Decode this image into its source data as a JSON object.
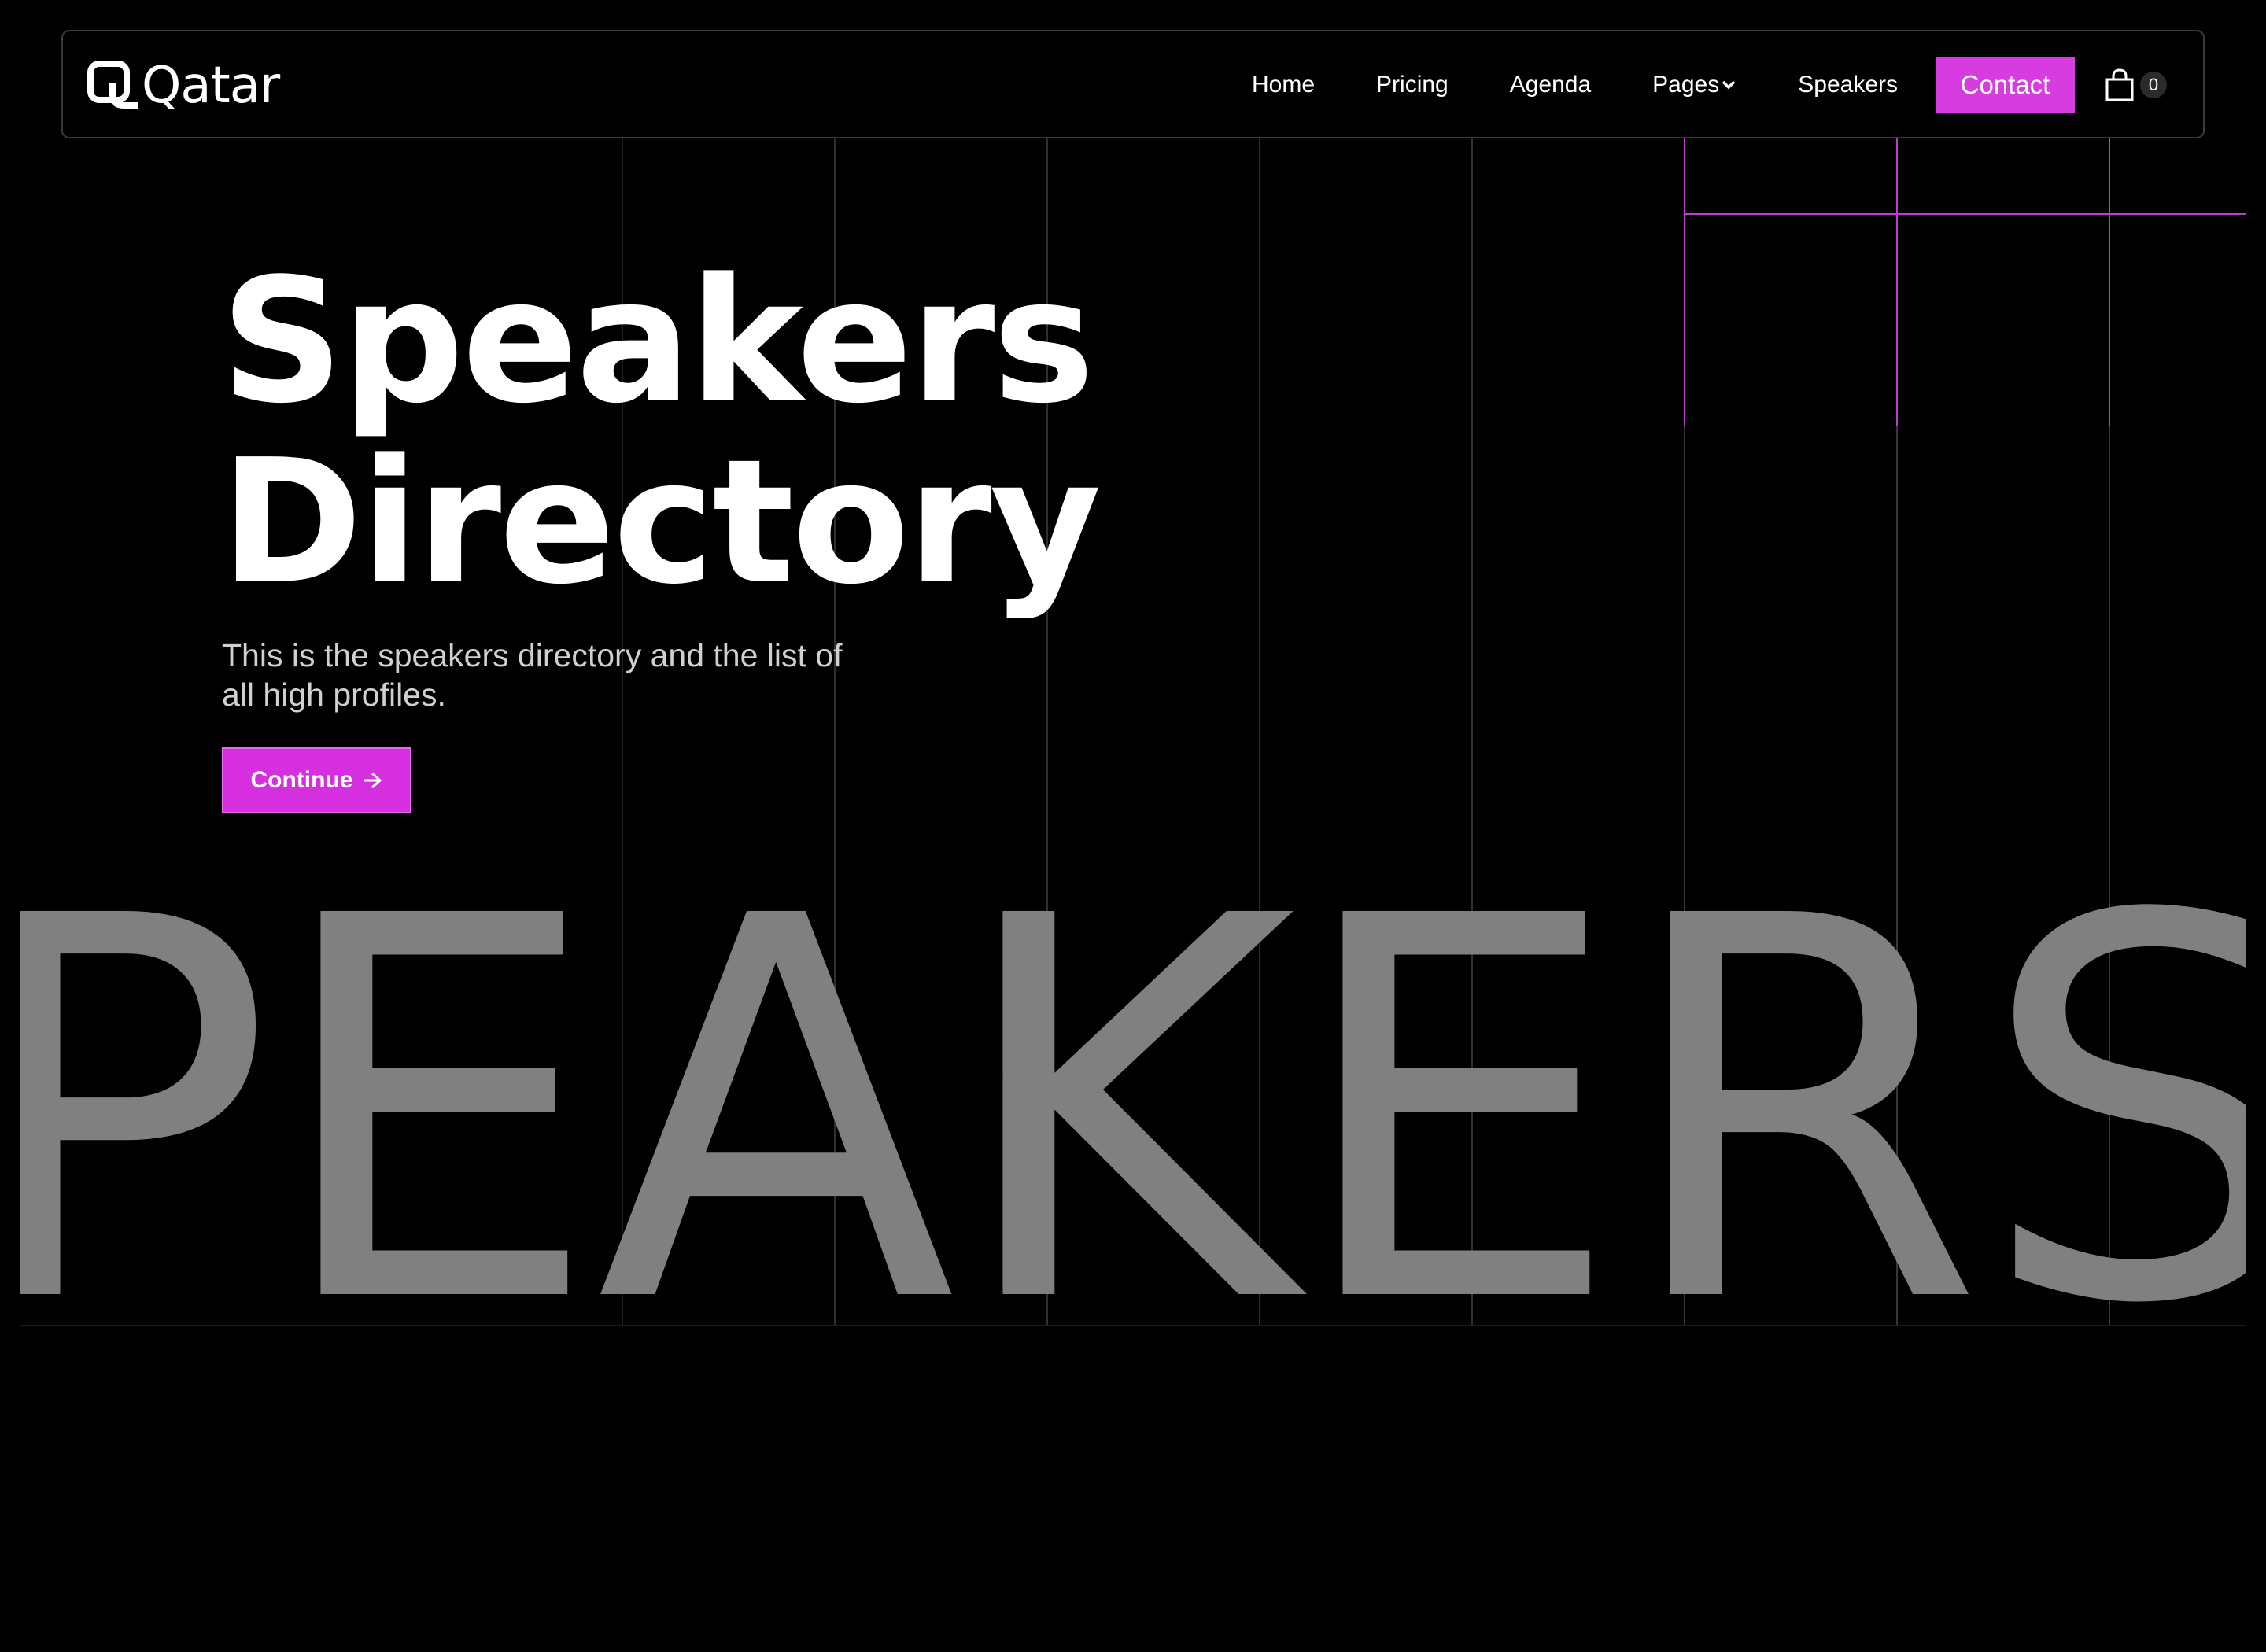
{
  "brand": {
    "name": "Qatar",
    "logo_icon": "q-logo-icon"
  },
  "nav": {
    "links": [
      "Home",
      "Pricing",
      "Agenda",
      "Pages",
      "Speakers"
    ],
    "pages_icon": "chevron-down-icon",
    "contact_label": "Contact",
    "cart_icon": "shopping-bag-icon",
    "cart_count": "0"
  },
  "hero": {
    "title_line1": "Speakers",
    "title_line2": "Directory",
    "subtitle": "This is the speakers directory and the list of all high profiles.",
    "cta_label": "Continue",
    "cta_icon": "arrow-right-icon"
  },
  "marquee": {
    "text": "SPEAKERS SPEAKERS"
  },
  "colors": {
    "background": "#000000",
    "accent": "#d63ce0",
    "grid_line": "#3c3c3c",
    "grid_highlight": "#c039d0",
    "marquee_text": "#808080"
  }
}
